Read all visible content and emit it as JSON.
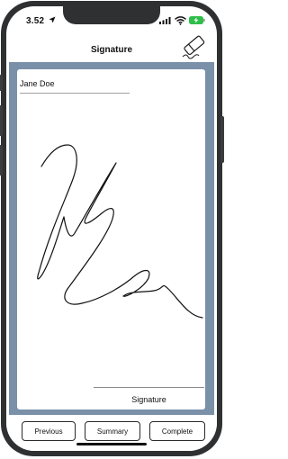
{
  "status_bar": {
    "time": "3.52",
    "icons": [
      "location-arrow-icon",
      "signal-bars-icon",
      "wifi-icon",
      "battery-charging-icon"
    ]
  },
  "nav": {
    "title": "Signature",
    "action_icon": "eraser-icon"
  },
  "signature_pad": {
    "signer_name": "Jane Doe",
    "signature_label": "Signature",
    "has_signature": true
  },
  "footer": {
    "previous_label": "Previous",
    "summary_label": "Summary",
    "complete_label": "Complete"
  },
  "colors": {
    "frame": "#7a90a8",
    "device": "#2f3032",
    "ink": "#111111"
  }
}
